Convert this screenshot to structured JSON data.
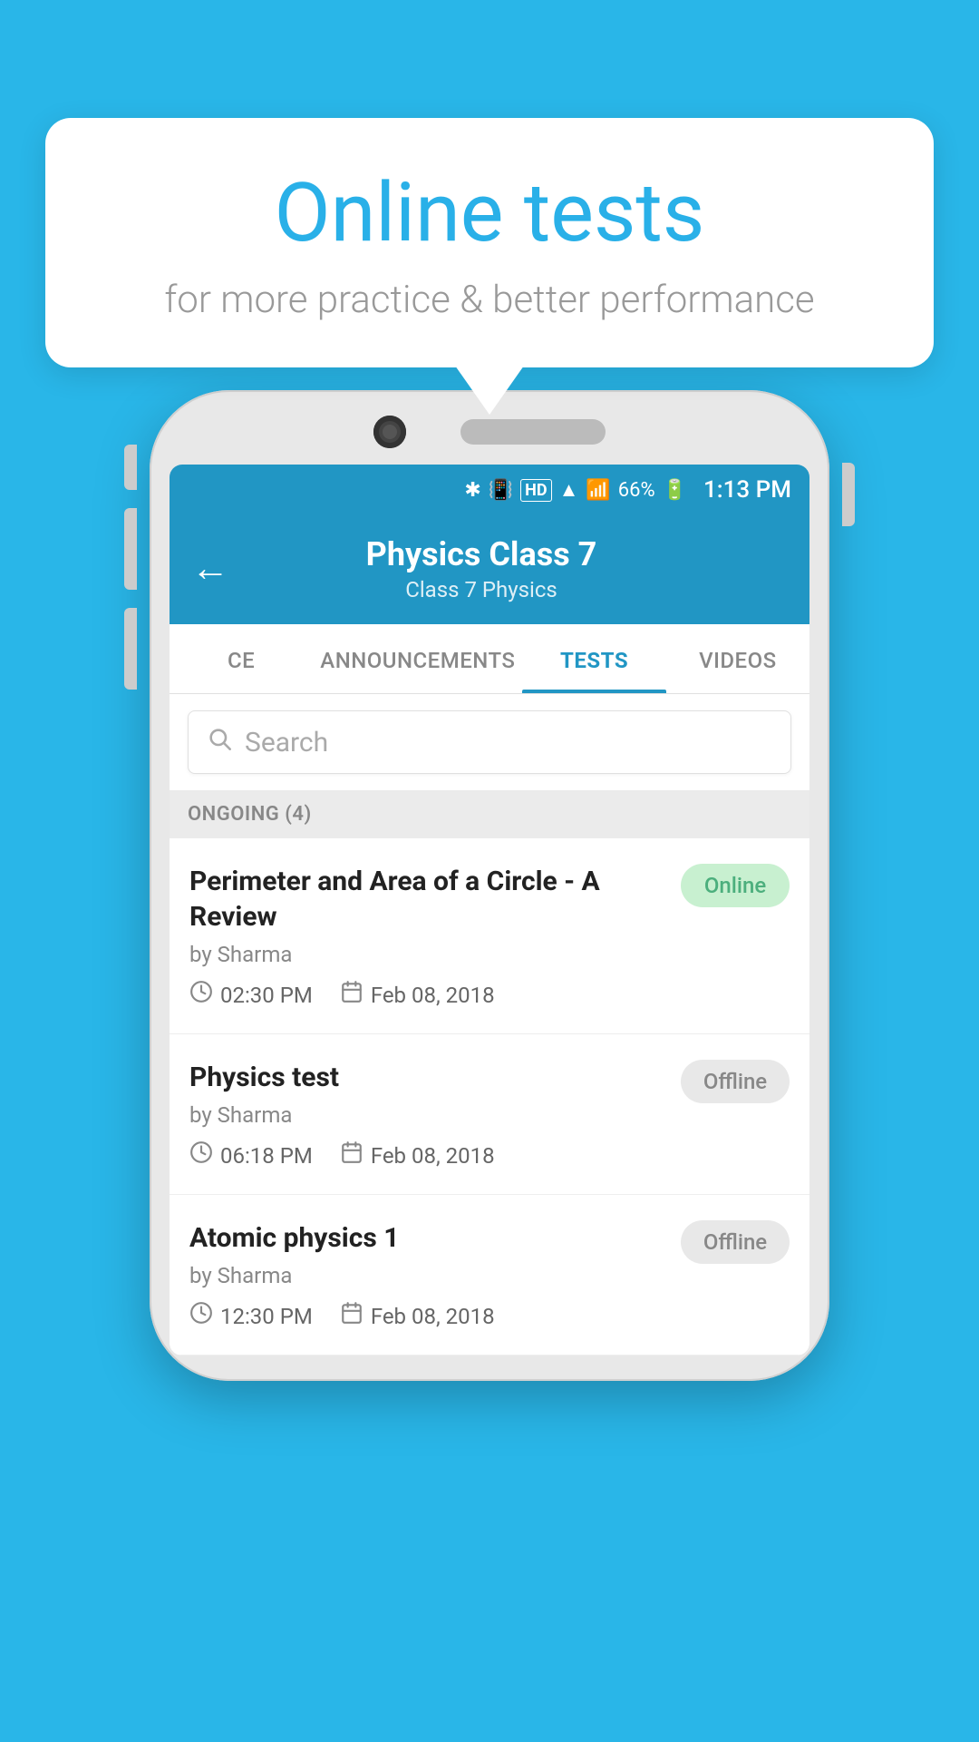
{
  "page": {
    "background_color": "#29b6e8"
  },
  "bubble": {
    "title": "Online tests",
    "subtitle": "for more practice & better performance"
  },
  "phone": {
    "status_bar": {
      "battery": "66%",
      "time": "1:13 PM"
    },
    "header": {
      "title": "Physics Class 7",
      "breadcrumb": "Class 7   Physics",
      "back_label": "←"
    },
    "tabs": [
      {
        "label": "CE",
        "active": false
      },
      {
        "label": "ANNOUNCEMENTS",
        "active": false
      },
      {
        "label": "TESTS",
        "active": true
      },
      {
        "label": "VIDEOS",
        "active": false
      }
    ],
    "search": {
      "placeholder": "Search"
    },
    "section": {
      "label": "ONGOING (4)"
    },
    "tests": [
      {
        "title": "Perimeter and Area of a Circle - A Review",
        "by": "by Sharma",
        "time": "02:30 PM",
        "date": "Feb 08, 2018",
        "status": "Online",
        "status_type": "online"
      },
      {
        "title": "Physics test",
        "by": "by Sharma",
        "time": "06:18 PM",
        "date": "Feb 08, 2018",
        "status": "Offline",
        "status_type": "offline"
      },
      {
        "title": "Atomic physics 1",
        "by": "by Sharma",
        "time": "12:30 PM",
        "date": "Feb 08, 2018",
        "status": "Offline",
        "status_type": "offline"
      }
    ]
  }
}
